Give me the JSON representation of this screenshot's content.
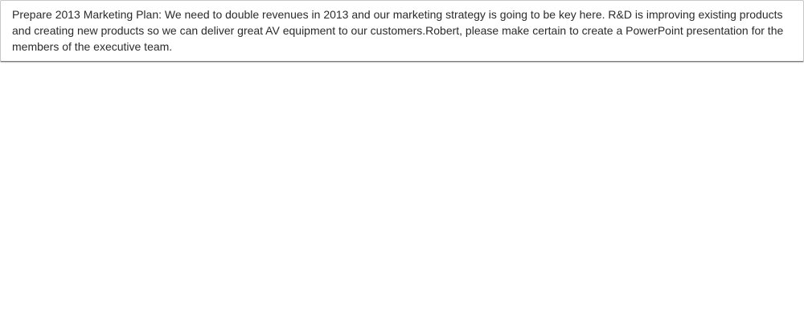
{
  "tooltip": {
    "text": "Prepare 2013 Marketing Plan: We need to double revenues in 2013 and our marketing strategy is going to be key here. R&D is improving existing products and creating new products so we can deliver great AV equipment to our customers.Robert, please make certain to create a PowerPoint presentation for the members of the executive team."
  }
}
